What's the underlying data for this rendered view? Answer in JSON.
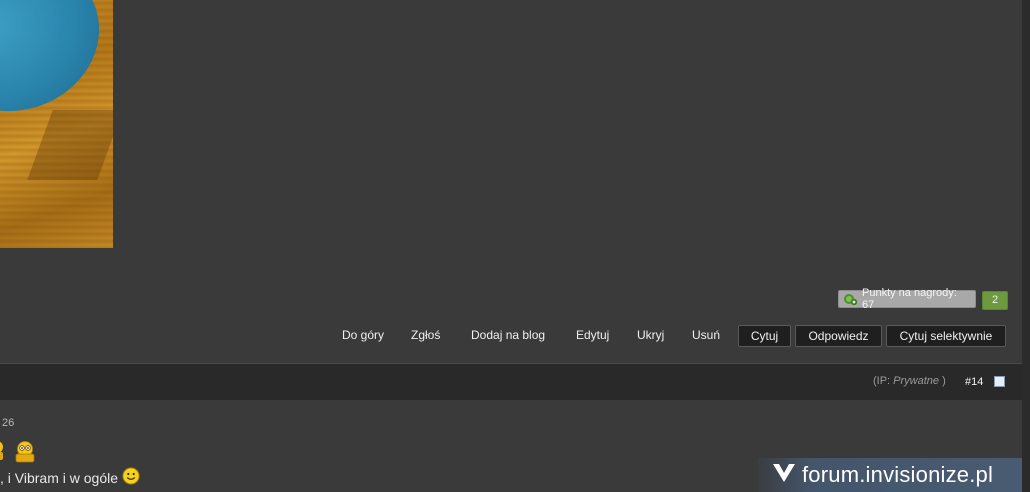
{
  "post": {
    "reward_points_label": "Punkty na nagrody: 67",
    "reputation_count": "2",
    "actions": {
      "top": "Do góry",
      "report": "Zgłoś",
      "add_to_blog": "Dodaj na blog",
      "edit": "Edytuj",
      "hide": "Ukryj",
      "delete": "Usuń",
      "quote": "Cytuj",
      "reply": "Odpowiedz",
      "selective_quote": "Cytuj selektywnie"
    }
  },
  "next_post": {
    "ip_prefix": "(IP: ",
    "ip_value": "Prywatne",
    "ip_suffix": " )",
    "post_number": "#14",
    "date_fragment": "26",
    "text_fragment": ", i Vibram i w ogóle"
  },
  "watermark": {
    "text": "forum.invisionize.pl"
  },
  "colors": {
    "background": "#3a3a3a",
    "header_bar": "#292929",
    "reputation_green": "#6d9a3e",
    "reward_gray": "#a8a8a8"
  },
  "icons": {
    "reward": "reward-points-icon",
    "emoji_1": "emoji-icon",
    "emoji_2": "emoji-icon",
    "smiley": "smiley-icon",
    "watermark_logo": "invisionize-logo-icon"
  }
}
